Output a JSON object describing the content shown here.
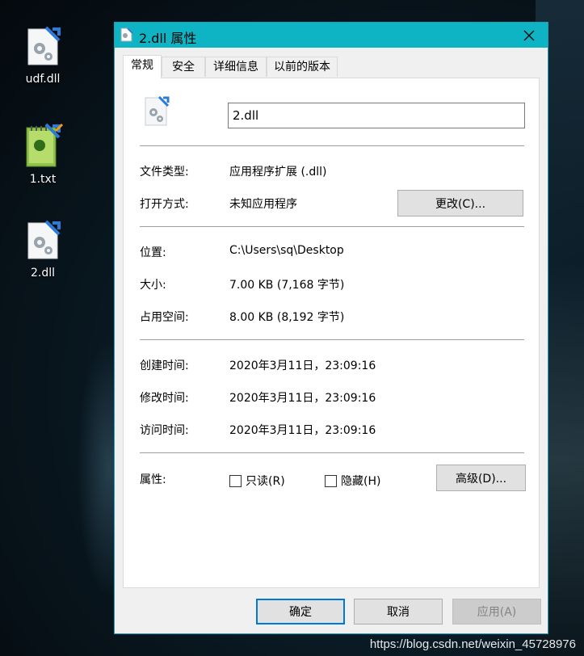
{
  "desktop": {
    "icons": [
      {
        "label": "udf.dll",
        "icon": "dll-file-icon"
      },
      {
        "label": "1.txt",
        "icon": "notepad-plus-file-icon"
      },
      {
        "label": "2.dll",
        "icon": "dll-file-icon"
      }
    ],
    "watermark": "https://blog.csdn.net/weixin_45728976"
  },
  "window": {
    "title": "2.dll 属性",
    "accent": "#0fb4c4",
    "tabs": [
      "常规",
      "安全",
      "详细信息",
      "以前的版本"
    ],
    "active_tab": "常规"
  },
  "general": {
    "file_name": "2.dll",
    "type_label": "文件类型:",
    "type_value": "应用程序扩展 (.dll)",
    "open_label": "打开方式:",
    "open_value": "未知应用程序",
    "change_button": "更改(C)...",
    "location_label": "位置:",
    "location_value": "C:\\Users\\sq\\Desktop",
    "size_label": "大小:",
    "size_value": "7.00 KB (7,168 字节)",
    "disk_label": "占用空间:",
    "disk_value": "8.00 KB (8,192 字节)",
    "created_label": "创建时间:",
    "created_value": "2020年3月11日，23:09:16",
    "modified_label": "修改时间:",
    "modified_value": "2020年3月11日，23:09:16",
    "accessed_label": "访问时间:",
    "accessed_value": "2020年3月11日，23:09:16",
    "attr_label": "属性:",
    "readonly_label": "只读(R)",
    "readonly_checked": false,
    "hidden_label": "隐藏(H)",
    "hidden_checked": false,
    "advanced_button": "高级(D)..."
  },
  "footer": {
    "ok": "确定",
    "cancel": "取消",
    "apply": "应用(A)"
  }
}
